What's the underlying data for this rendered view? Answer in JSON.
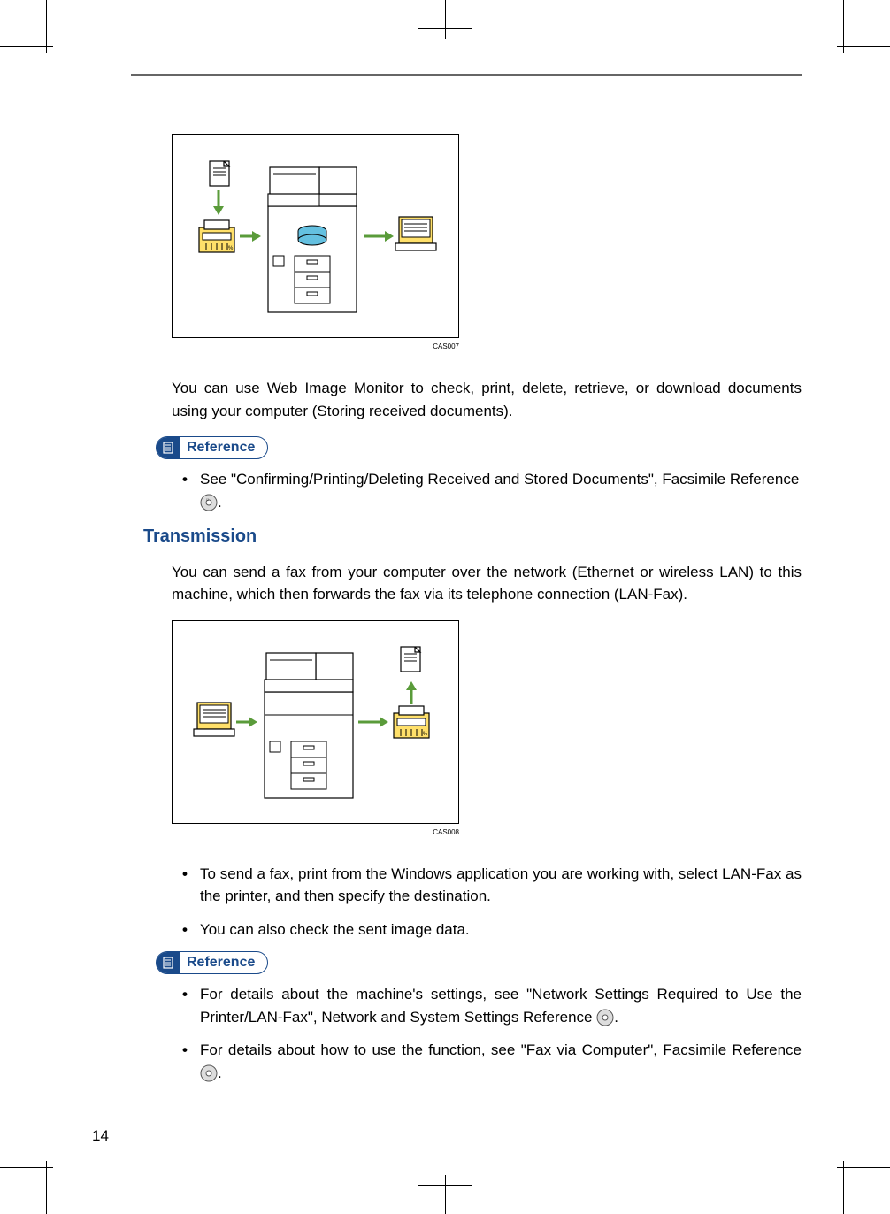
{
  "page_number": "14",
  "figure1": {
    "caption": "CAS007"
  },
  "body1": "You can use Web Image Monitor to check, print, delete, retrieve, or download documents using your computer (Storing received documents).",
  "reference_label": "Reference",
  "ref1_item": "See \"Confirming/Printing/Deleting Received and Stored Documents\", Facsimile Reference",
  "ref1_suffix": ".",
  "section_heading": "Transmission",
  "body2": "You can send a fax from your computer over the network (Ethernet or wireless LAN) to this machine, which then forwards the fax via its telephone connection (LAN-Fax).",
  "figure2": {
    "caption": "CAS008"
  },
  "bullets2": [
    "To send a fax, print from the Windows application you are working with, select LAN-Fax as the printer, and then specify the destination.",
    "You can also check the sent image data."
  ],
  "ref2_items": [
    {
      "text": "For details about the machine's settings, see \"Network Settings Required to Use the Printer/LAN-Fax\", Network and System Settings Reference",
      "suffix": "."
    },
    {
      "text": "For details about how to use the function, see \"Fax via Computer\", Facsimile Reference",
      "suffix": "."
    }
  ]
}
